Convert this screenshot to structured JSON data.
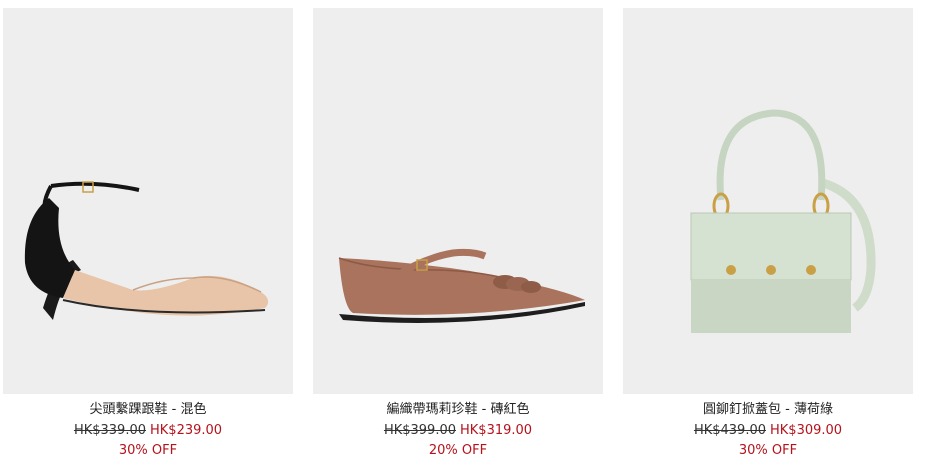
{
  "products": [
    {
      "name": "尖頭繫踝跟鞋 - 混色",
      "original_price": "HK$339.00",
      "sale_price": "HK$239.00",
      "discount": "30% OFF",
      "image_icon": "ankle-strap-pump-image"
    },
    {
      "name": "編織帶瑪莉珍鞋 - 磚紅色",
      "original_price": "HK$399.00",
      "sale_price": "HK$319.00",
      "discount": "20% OFF",
      "image_icon": "mary-jane-flat-image"
    },
    {
      "name": "圓鉚釘掀蓋包 - 薄荷綠",
      "original_price": "HK$439.00",
      "sale_price": "HK$309.00",
      "discount": "30% OFF",
      "image_icon": "top-handle-bag-image"
    }
  ],
  "colors": {
    "image_bg": "#eeeeee",
    "sale_red": "#b5121b",
    "text": "#222222"
  }
}
